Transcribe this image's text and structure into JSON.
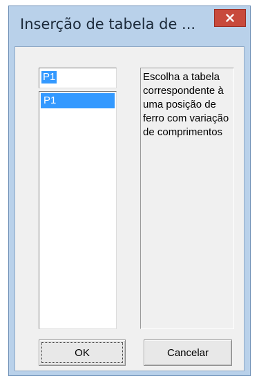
{
  "window": {
    "title": "Inserção de tabela de ...",
    "close_icon": "close-icon"
  },
  "combo": {
    "value": "P1"
  },
  "list": {
    "items": [
      {
        "label": "P1",
        "selected": true
      }
    ]
  },
  "hint": {
    "text": "Escolha a tabela correspondente à uma posição de ferro com variação de comprimentos"
  },
  "buttons": {
    "ok_label": "OK",
    "cancel_label": "Cancelar"
  },
  "colors": {
    "frame": "#b9d1ea",
    "close": "#c84a3c",
    "selection": "#3399ff",
    "client": "#f0f0f0"
  }
}
